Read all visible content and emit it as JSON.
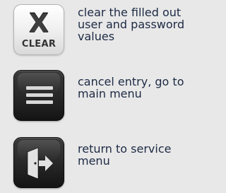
{
  "rows": [
    {
      "icon": "clear-x-icon",
      "icon_text_top": "X",
      "icon_text_bottom": "CLEAR",
      "description_lines": [
        "clear the filled out",
        "user and password",
        "values"
      ]
    },
    {
      "icon": "menu-lines-icon",
      "description_lines": [
        "cancel entry, go to",
        "main menu"
      ]
    },
    {
      "icon": "exit-door-icon",
      "description_lines": [
        "return to service",
        "menu"
      ]
    }
  ],
  "colors": {
    "background": "#e8e8e8",
    "text": "#1d2a44",
    "light_button": "#eeeeee",
    "dark_button": "#222222",
    "icon_light": "#d8d8d8"
  }
}
